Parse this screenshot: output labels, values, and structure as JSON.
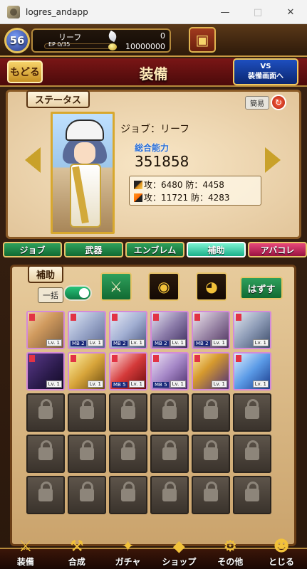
{
  "window": {
    "title": "logres_andapp"
  },
  "player": {
    "level": "56",
    "name": "リーフ",
    "exp_text": "EP 0/35",
    "exp_fraction": 0.0,
    "feathers": "0",
    "gold": "10000000"
  },
  "header": {
    "back_label": "もどる",
    "title": "装備",
    "vs_label_line1": "VS",
    "vs_label_line2": "装備画面へ"
  },
  "status": {
    "section_label": "ステータス",
    "simple_label": "簡易",
    "job": "ジョブ：リーフ",
    "power_label": "総合能力",
    "power_value": "351858",
    "phys_line": "攻：6480  防：4458",
    "mag_line": "攻：11721  防：4283"
  },
  "tabs": [
    "ジョブ",
    "武器",
    "エンブレム",
    "補助",
    "アバコレ"
  ],
  "active_tab_index": 3,
  "support": {
    "section_label": "補助",
    "bulk_label": "一括",
    "bulk_on": true,
    "remove_label": "はずす"
  },
  "cards": [
    {
      "lv": "Lv. 1",
      "mb": ""
    },
    {
      "lv": "Lv. 1",
      "mb": "MB 2"
    },
    {
      "lv": "Lv. 1",
      "mb": "MB 2"
    },
    {
      "lv": "Lv. 1",
      "mb": "MB 2"
    },
    {
      "lv": "Lv. 1",
      "mb": "MB 2"
    },
    {
      "lv": "Lv. 1",
      "mb": ""
    },
    {
      "lv": "Lv. 1",
      "mb": ""
    },
    {
      "lv": "Lv. 1",
      "mb": ""
    },
    {
      "lv": "Lv. 1",
      "mb": "MB 5"
    },
    {
      "lv": "Lv. 1",
      "mb": "MB 5"
    },
    {
      "lv": "Lv. 1",
      "mb": ""
    },
    {
      "lv": "Lv. 1",
      "mb": ""
    }
  ],
  "locked_slots": 18,
  "bottom_nav": [
    "装備",
    "合成",
    "ガチャ",
    "ショップ",
    "その他",
    "とじる"
  ],
  "colors": {
    "accent_gold": "#c9a12a",
    "tab_green": "#2ea05c",
    "header_red": "#7a1616"
  }
}
